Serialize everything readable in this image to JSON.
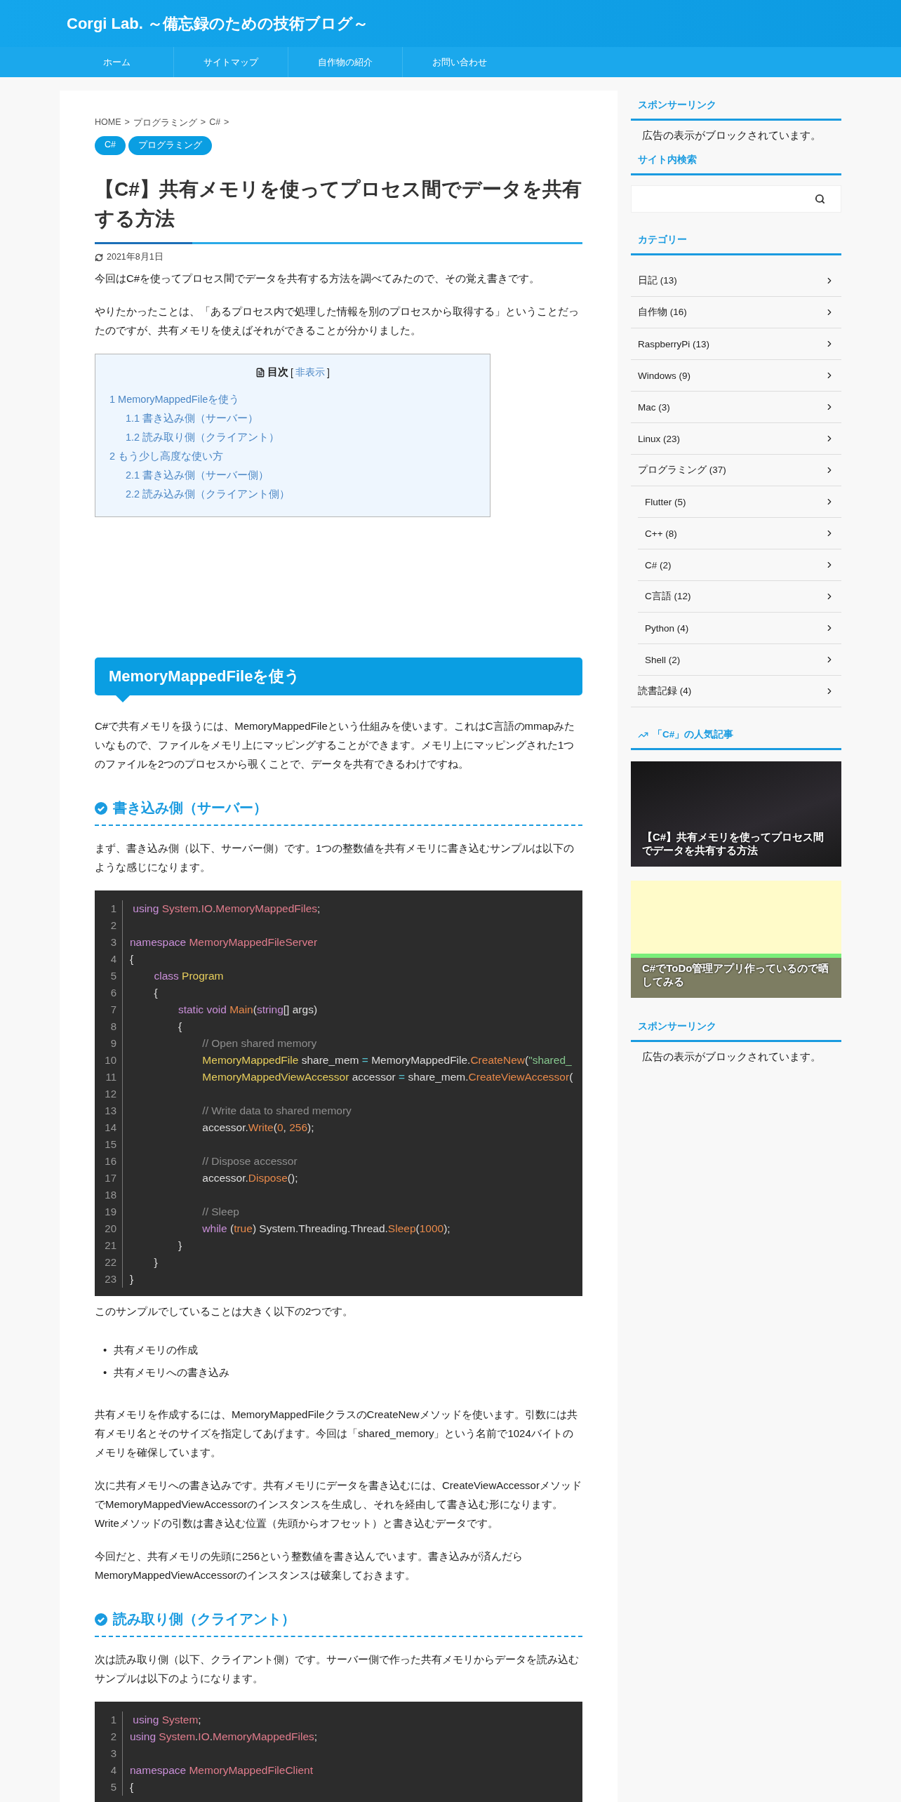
{
  "site": {
    "title": "Corgi Lab. ～備忘録のための技術ブログ～"
  },
  "nav": [
    "ホーム",
    "サイトマップ",
    "自作物の紹介",
    "お問い合わせ"
  ],
  "breadcrumb": {
    "separator": ">",
    "items": [
      "HOME",
      "プログラミング",
      "C#"
    ]
  },
  "tags": [
    "C#",
    "プログラミング"
  ],
  "article": {
    "title": "【C#】共有メモリを使ってプロセス間でデータを共有する方法",
    "date": "2021年8月1日",
    "body": [
      {
        "kind": "p",
        "text": "今回はC#を使ってプロセス間でデータを共有する方法を調べてみたので、その覚え書きです。"
      },
      {
        "kind": "p",
        "text": "やりたかったことは、「あるプロセス内で処理した情報を別のプロセスから取得する」ということだったのですが、共有メモリを使えばそれができることが分かりました。"
      },
      {
        "kind": "toc",
        "title": "目次",
        "brackets": [
          "[",
          "]"
        ],
        "toggle": "非表示",
        "items": [
          {
            "label": "1 MemoryMappedFileを使う",
            "children": [
              {
                "label": "1.1 書き込み側（サーバー）"
              },
              {
                "label": "1.2 読み取り側（クライアント）"
              }
            ]
          },
          {
            "label": "2 もう少し高度な使い方",
            "children": [
              {
                "label": "2.1 書き込み側（サーバー側）"
              },
              {
                "label": "2.2 読み込み側（クライアント側）"
              }
            ]
          }
        ]
      },
      {
        "kind": "h2",
        "text": "MemoryMappedFileを使う"
      },
      {
        "kind": "p",
        "text": "C#で共有メモリを扱うには、MemoryMappedFileという仕組みを使います。これはC言語のmmapみたいなもので、ファイルをメモリ上にマッピングすることができます。メモリ上にマッピングされた1つのファイルを2つのプロセスから覗くことで、データを共有できるわけですね。"
      },
      {
        "kind": "h3",
        "text": "書き込み側（サーバー）"
      },
      {
        "kind": "p",
        "text": "まず、書き込み側（以下、サーバー側）です。1つの整数値を共有メモリに書き込むサンプルは以下のような感じになります。"
      },
      {
        "kind": "code",
        "lines": [
          {
            "n": "1",
            "tokens": [
              {
                "t": " using",
                "kind": "keyword"
              },
              {
                "t": " System",
                "kind": "namespace"
              },
              {
                "t": ".",
                "kind": "plain"
              },
              {
                "t": "IO",
                "kind": "namespace"
              },
              {
                "t": ".",
                "kind": "plain"
              },
              {
                "t": "MemoryMappedFiles",
                "kind": "namespace"
              },
              {
                "t": ";",
                "kind": "plain"
              }
            ]
          },
          {
            "n": "2"
          },
          {
            "n": "3",
            "tokens": [
              {
                "t": "namespace",
                "kind": "keyword"
              },
              {
                "t": " MemoryMappedFileServer",
                "kind": "namespace"
              }
            ]
          },
          {
            "n": "4",
            "tokens": [
              {
                "t": "{",
                "kind": "plain"
              }
            ]
          },
          {
            "n": "5",
            "tokens": [
              {
                "t": "        class",
                "kind": "keyword"
              },
              {
                "t": " Program",
                "kind": "type"
              }
            ]
          },
          {
            "n": "6",
            "tokens": [
              {
                "t": "        {",
                "kind": "plain"
              }
            ]
          },
          {
            "n": "7",
            "tokens": [
              {
                "t": "                static void",
                "kind": "keyword"
              },
              {
                "t": " Main",
                "kind": "function"
              },
              {
                "t": "(",
                "kind": "plain"
              },
              {
                "t": "string",
                "kind": "keyword"
              },
              {
                "t": "[] args)",
                "kind": "plain"
              }
            ]
          },
          {
            "n": "8",
            "tokens": [
              {
                "t": "                {",
                "kind": "plain"
              }
            ]
          },
          {
            "n": "9",
            "tokens": [
              {
                "t": "                        // Open shared memory",
                "kind": "comment"
              }
            ]
          },
          {
            "n": "10",
            "tokens": [
              {
                "t": "                        MemoryMappedFile",
                "kind": "type"
              },
              {
                "t": " share_mem ",
                "kind": "plain"
              },
              {
                "t": "=",
                "kind": "operator"
              },
              {
                "t": " MemoryMappedFile.",
                "kind": "plain"
              },
              {
                "t": "CreateNew",
                "kind": "function"
              },
              {
                "t": "(",
                "kind": "plain"
              },
              {
                "t": "\"shared_",
                "kind": "string"
              }
            ]
          },
          {
            "n": "11",
            "tokens": [
              {
                "t": "                        MemoryMappedViewAccessor",
                "kind": "type"
              },
              {
                "t": " accessor ",
                "kind": "plain"
              },
              {
                "t": "=",
                "kind": "operator"
              },
              {
                "t": " share_mem.",
                "kind": "plain"
              },
              {
                "t": "CreateViewAccessor",
                "kind": "function"
              },
              {
                "t": "(",
                "kind": "plain"
              }
            ]
          },
          {
            "n": "12"
          },
          {
            "n": "13",
            "tokens": [
              {
                "t": "                        // Write data to shared memory",
                "kind": "comment"
              }
            ]
          },
          {
            "n": "14",
            "tokens": [
              {
                "t": "                        accessor.",
                "kind": "plain"
              },
              {
                "t": "Write",
                "kind": "function"
              },
              {
                "t": "(",
                "kind": "plain"
              },
              {
                "t": "0",
                "kind": "number"
              },
              {
                "t": ", ",
                "kind": "plain"
              },
              {
                "t": "256",
                "kind": "number"
              },
              {
                "t": ");",
                "kind": "plain"
              }
            ]
          },
          {
            "n": "15"
          },
          {
            "n": "16",
            "tokens": [
              {
                "t": "                        // Dispose accessor",
                "kind": "comment"
              }
            ]
          },
          {
            "n": "17",
            "tokens": [
              {
                "t": "                        accessor.",
                "kind": "plain"
              },
              {
                "t": "Dispose",
                "kind": "function"
              },
              {
                "t": "();",
                "kind": "plain"
              }
            ]
          },
          {
            "n": "18"
          },
          {
            "n": "19",
            "tokens": [
              {
                "t": "                        // Sleep",
                "kind": "comment"
              }
            ]
          },
          {
            "n": "20",
            "tokens": [
              {
                "t": "                        while",
                "kind": "keyword"
              },
              {
                "t": " (",
                "kind": "plain"
              },
              {
                "t": "true",
                "kind": "number"
              },
              {
                "t": ") System.Threading.Thread.",
                "kind": "plain"
              },
              {
                "t": "Sleep",
                "kind": "function"
              },
              {
                "t": "(",
                "kind": "plain"
              },
              {
                "t": "1000",
                "kind": "number"
              },
              {
                "t": ");",
                "kind": "plain"
              }
            ]
          },
          {
            "n": "21",
            "tokens": [
              {
                "t": "                }",
                "kind": "plain"
              }
            ]
          },
          {
            "n": "22",
            "tokens": [
              {
                "t": "        }",
                "kind": "plain"
              }
            ]
          },
          {
            "n": "23",
            "tokens": [
              {
                "t": "}",
                "kind": "plain"
              }
            ]
          }
        ]
      },
      {
        "kind": "p",
        "text": "このサンプルでしていることは大きく以下の2つです。"
      },
      {
        "kind": "ul",
        "marker": "•",
        "items": [
          "共有メモリの作成",
          "共有メモリへの書き込み"
        ]
      },
      {
        "kind": "p",
        "text": "共有メモリを作成するには、MemoryMappedFileクラスのCreateNewメソッドを使います。引数には共有メモリ名とそのサイズを指定してあげます。今回は「shared_memory」という名前で1024バイトのメモリを確保しています。"
      },
      {
        "kind": "p",
        "text": "次に共有メモリへの書き込みです。共有メモリにデータを書き込むには、CreateViewAccessorメソッドでMemoryMappedViewAccessorのインスタンスを生成し、それを経由して書き込む形になります。Writeメソッドの引数は書き込む位置（先頭からオフセット）と書き込むデータです。"
      },
      {
        "kind": "p",
        "text": "今回だと、共有メモリの先頭に256という整数値を書き込んでいます。書き込みが済んだらMemoryMappedViewAccessorのインスタンスは破棄しておきます。"
      },
      {
        "kind": "h3",
        "text": "読み取り側（クライアント）"
      },
      {
        "kind": "p",
        "text": "次は読み取り側（以下、クライアント側）です。サーバー側で作った共有メモリからデータを読み込むサンプルは以下のようになります。"
      },
      {
        "kind": "code",
        "lines": [
          {
            "n": "1",
            "tokens": [
              {
                "t": " using",
                "kind": "keyword"
              },
              {
                "t": " System",
                "kind": "namespace"
              },
              {
                "t": ";",
                "kind": "plain"
              }
            ]
          },
          {
            "n": "2",
            "tokens": [
              {
                "t": "using",
                "kind": "keyword"
              },
              {
                "t": " System",
                "kind": "namespace"
              },
              {
                "t": ".",
                "kind": "plain"
              },
              {
                "t": "IO",
                "kind": "namespace"
              },
              {
                "t": ".",
                "kind": "plain"
              },
              {
                "t": "MemoryMappedFiles",
                "kind": "namespace"
              },
              {
                "t": ";",
                "kind": "plain"
              }
            ]
          },
          {
            "n": "3"
          },
          {
            "n": "4",
            "tokens": [
              {
                "t": "namespace",
                "kind": "keyword"
              },
              {
                "t": " MemoryMappedFileClient",
                "kind": "namespace"
              }
            ]
          },
          {
            "n": "5",
            "tokens": [
              {
                "t": "{",
                "kind": "plain"
              }
            ]
          }
        ]
      }
    ]
  },
  "sidebar": [
    {
      "kind": "ad",
      "heading": "スポンサーリンク",
      "text": "広告の表示がブロックされています。"
    },
    {
      "kind": "search",
      "heading": "サイト内検索"
    },
    {
      "kind": "categories",
      "heading": "カテゴリー",
      "items": [
        {
          "label": "日記 (13)"
        },
        {
          "label": "自作物 (16)"
        },
        {
          "label": "RaspberryPi (13)"
        },
        {
          "label": "Windows (9)"
        },
        {
          "label": "Mac (3)"
        },
        {
          "label": "Linux (23)"
        },
        {
          "label": "プログラミング (37)",
          "children": [
            {
              "label": "Flutter (5)"
            },
            {
              "label": "C++ (8)"
            },
            {
              "label": "C# (2)"
            },
            {
              "label": "C言語 (12)"
            },
            {
              "label": "Python (4)"
            },
            {
              "label": "Shell (2)"
            }
          ]
        },
        {
          "label": "読書記録 (4)"
        }
      ]
    },
    {
      "kind": "popular",
      "heading": "「C#」の人気記事",
      "items": [
        {
          "title": "【C#】共有メモリを使ってプロセス間でデータを共有する方法"
        },
        {
          "title": "C#でToDo管理アプリ作っているので晒してみる"
        }
      ]
    },
    {
      "kind": "ad",
      "heading": "スポンサーリンク",
      "text": "広告の表示がブロックされています。"
    }
  ]
}
